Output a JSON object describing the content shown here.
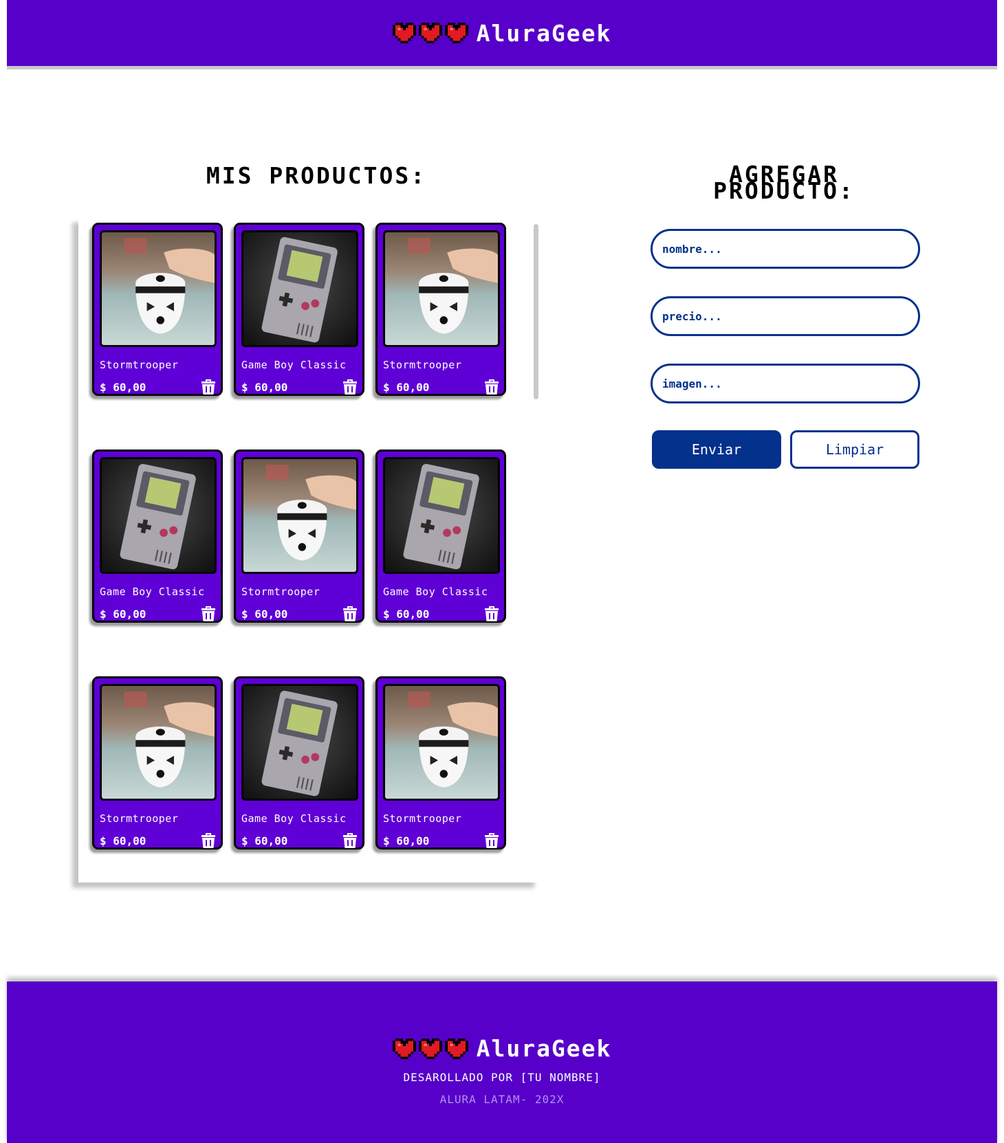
{
  "brand": {
    "name": "AluraGeek",
    "icon": "pixel-heart-icon",
    "heart_color": "#e01b24"
  },
  "colors": {
    "primary_purple": "#5600c9",
    "card_purple": "#5f00d6",
    "form_blue": "#03318c"
  },
  "products_section": {
    "title": "MIS PRODUCTOS:",
    "items": [
      {
        "name": "Stormtrooper",
        "price": "$ 60,00",
        "image": "stormtrooper-image"
      },
      {
        "name": "Game Boy Classic",
        "price": "$ 60,00",
        "image": "gameboy-image"
      },
      {
        "name": "Stormtrooper",
        "price": "$ 60,00",
        "image": "stormtrooper-image"
      },
      {
        "name": "Game Boy Classic",
        "price": "$ 60,00",
        "image": "gameboy-image"
      },
      {
        "name": "Stormtrooper",
        "price": "$ 60,00",
        "image": "stormtrooper-image"
      },
      {
        "name": "Game Boy Classic",
        "price": "$ 60,00",
        "image": "gameboy-image"
      },
      {
        "name": "Stormtrooper",
        "price": "$ 60,00",
        "image": "stormtrooper-image"
      },
      {
        "name": "Game Boy Classic",
        "price": "$ 60,00",
        "image": "gameboy-image"
      },
      {
        "name": "Stormtrooper",
        "price": "$ 60,00",
        "image": "stormtrooper-image"
      }
    ],
    "delete_icon": "trash-icon"
  },
  "form": {
    "title_line1": "AGREGAR",
    "title_line2": "PRODUCTO:",
    "name_placeholder": "nombre...",
    "price_placeholder": "precio...",
    "image_placeholder": "imagen...",
    "submit_label": "Enviar",
    "clear_label": "Limpiar"
  },
  "footer": {
    "developed_by": "DESAROLLADO POR [TU NOMBRE]",
    "copyright": "ALURA LATAM- 202X"
  }
}
